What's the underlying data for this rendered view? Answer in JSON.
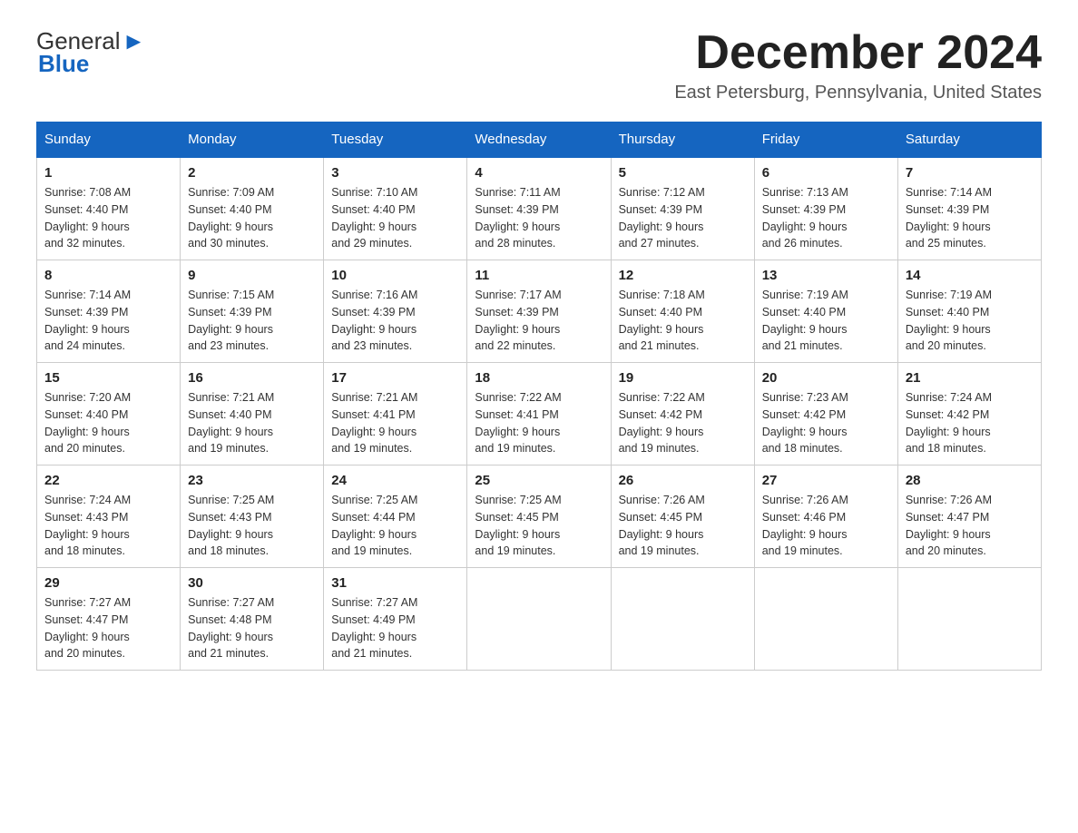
{
  "logo": {
    "general": "General",
    "blue": "Blue"
  },
  "title": {
    "month_year": "December 2024",
    "location": "East Petersburg, Pennsylvania, United States"
  },
  "days_of_week": [
    "Sunday",
    "Monday",
    "Tuesday",
    "Wednesday",
    "Thursday",
    "Friday",
    "Saturday"
  ],
  "weeks": [
    [
      {
        "day": "1",
        "sunrise": "7:08 AM",
        "sunset": "4:40 PM",
        "daylight": "9 hours and 32 minutes."
      },
      {
        "day": "2",
        "sunrise": "7:09 AM",
        "sunset": "4:40 PM",
        "daylight": "9 hours and 30 minutes."
      },
      {
        "day": "3",
        "sunrise": "7:10 AM",
        "sunset": "4:40 PM",
        "daylight": "9 hours and 29 minutes."
      },
      {
        "day": "4",
        "sunrise": "7:11 AM",
        "sunset": "4:39 PM",
        "daylight": "9 hours and 28 minutes."
      },
      {
        "day": "5",
        "sunrise": "7:12 AM",
        "sunset": "4:39 PM",
        "daylight": "9 hours and 27 minutes."
      },
      {
        "day": "6",
        "sunrise": "7:13 AM",
        "sunset": "4:39 PM",
        "daylight": "9 hours and 26 minutes."
      },
      {
        "day": "7",
        "sunrise": "7:14 AM",
        "sunset": "4:39 PM",
        "daylight": "9 hours and 25 minutes."
      }
    ],
    [
      {
        "day": "8",
        "sunrise": "7:14 AM",
        "sunset": "4:39 PM",
        "daylight": "9 hours and 24 minutes."
      },
      {
        "day": "9",
        "sunrise": "7:15 AM",
        "sunset": "4:39 PM",
        "daylight": "9 hours and 23 minutes."
      },
      {
        "day": "10",
        "sunrise": "7:16 AM",
        "sunset": "4:39 PM",
        "daylight": "9 hours and 23 minutes."
      },
      {
        "day": "11",
        "sunrise": "7:17 AM",
        "sunset": "4:39 PM",
        "daylight": "9 hours and 22 minutes."
      },
      {
        "day": "12",
        "sunrise": "7:18 AM",
        "sunset": "4:40 PM",
        "daylight": "9 hours and 21 minutes."
      },
      {
        "day": "13",
        "sunrise": "7:19 AM",
        "sunset": "4:40 PM",
        "daylight": "9 hours and 21 minutes."
      },
      {
        "day": "14",
        "sunrise": "7:19 AM",
        "sunset": "4:40 PM",
        "daylight": "9 hours and 20 minutes."
      }
    ],
    [
      {
        "day": "15",
        "sunrise": "7:20 AM",
        "sunset": "4:40 PM",
        "daylight": "9 hours and 20 minutes."
      },
      {
        "day": "16",
        "sunrise": "7:21 AM",
        "sunset": "4:40 PM",
        "daylight": "9 hours and 19 minutes."
      },
      {
        "day": "17",
        "sunrise": "7:21 AM",
        "sunset": "4:41 PM",
        "daylight": "9 hours and 19 minutes."
      },
      {
        "day": "18",
        "sunrise": "7:22 AM",
        "sunset": "4:41 PM",
        "daylight": "9 hours and 19 minutes."
      },
      {
        "day": "19",
        "sunrise": "7:22 AM",
        "sunset": "4:42 PM",
        "daylight": "9 hours and 19 minutes."
      },
      {
        "day": "20",
        "sunrise": "7:23 AM",
        "sunset": "4:42 PM",
        "daylight": "9 hours and 18 minutes."
      },
      {
        "day": "21",
        "sunrise": "7:24 AM",
        "sunset": "4:42 PM",
        "daylight": "9 hours and 18 minutes."
      }
    ],
    [
      {
        "day": "22",
        "sunrise": "7:24 AM",
        "sunset": "4:43 PM",
        "daylight": "9 hours and 18 minutes."
      },
      {
        "day": "23",
        "sunrise": "7:25 AM",
        "sunset": "4:43 PM",
        "daylight": "9 hours and 18 minutes."
      },
      {
        "day": "24",
        "sunrise": "7:25 AM",
        "sunset": "4:44 PM",
        "daylight": "9 hours and 19 minutes."
      },
      {
        "day": "25",
        "sunrise": "7:25 AM",
        "sunset": "4:45 PM",
        "daylight": "9 hours and 19 minutes."
      },
      {
        "day": "26",
        "sunrise": "7:26 AM",
        "sunset": "4:45 PM",
        "daylight": "9 hours and 19 minutes."
      },
      {
        "day": "27",
        "sunrise": "7:26 AM",
        "sunset": "4:46 PM",
        "daylight": "9 hours and 19 minutes."
      },
      {
        "day": "28",
        "sunrise": "7:26 AM",
        "sunset": "4:47 PM",
        "daylight": "9 hours and 20 minutes."
      }
    ],
    [
      {
        "day": "29",
        "sunrise": "7:27 AM",
        "sunset": "4:47 PM",
        "daylight": "9 hours and 20 minutes."
      },
      {
        "day": "30",
        "sunrise": "7:27 AM",
        "sunset": "4:48 PM",
        "daylight": "9 hours and 21 minutes."
      },
      {
        "day": "31",
        "sunrise": "7:27 AM",
        "sunset": "4:49 PM",
        "daylight": "9 hours and 21 minutes."
      },
      null,
      null,
      null,
      null
    ]
  ],
  "labels": {
    "sunrise": "Sunrise: ",
    "sunset": "Sunset: ",
    "daylight": "Daylight: "
  }
}
